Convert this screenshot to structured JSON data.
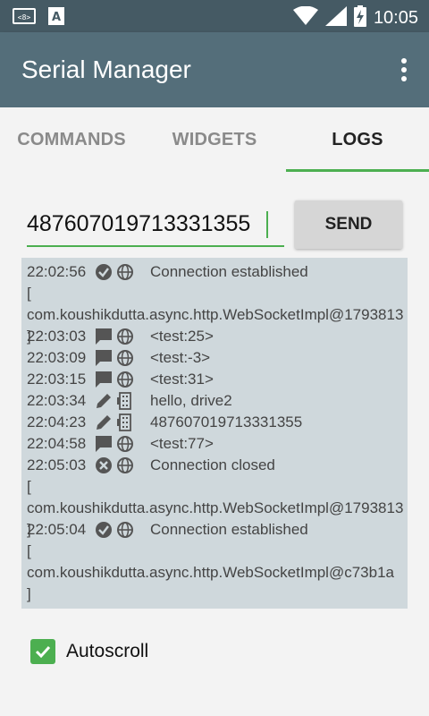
{
  "status_bar": {
    "time": "10:05",
    "icons": [
      "code-icon",
      "text-icon",
      "wifi-icon",
      "signal-icon",
      "battery-charging-icon"
    ]
  },
  "app_bar": {
    "title": "Serial Manager",
    "menu_icon": "more-vert-icon"
  },
  "tabs": [
    {
      "label": "COMMANDS",
      "active": false
    },
    {
      "label": "WIDGETS",
      "active": false
    },
    {
      "label": "LOGS",
      "active": true
    }
  ],
  "input": {
    "value": "487607019713331355"
  },
  "send_button": {
    "label": "SEND"
  },
  "log": {
    "entries": [
      {
        "time": "22:02:56",
        "icon1": "check-circle-icon",
        "icon2": "globe-icon",
        "message": "Connection established",
        "detail": "[ com.koushikdutta.async.http.WebSocketImpl@1793813 ]"
      },
      {
        "time": "22:03:03",
        "icon1": "message-icon",
        "icon2": "globe-icon",
        "message": "<test:25>"
      },
      {
        "time": "22:03:09",
        "icon1": "message-icon",
        "icon2": "globe-icon",
        "message": "<test:-3>"
      },
      {
        "time": "22:03:15",
        "icon1": "message-icon",
        "icon2": "globe-icon",
        "message": "<test:31>"
      },
      {
        "time": "22:03:34",
        "icon1": "pencil-icon",
        "icon2": "serial-port-icon",
        "message": "hello, drive2"
      },
      {
        "time": "22:04:23",
        "icon1": "pencil-icon",
        "icon2": "serial-port-icon",
        "message": "487607019713331355"
      },
      {
        "time": "22:04:58",
        "icon1": "message-icon",
        "icon2": "globe-icon",
        "message": "<test:77>"
      },
      {
        "time": "22:05:03",
        "icon1": "close-circle-icon",
        "icon2": "globe-icon",
        "message": "Connection closed",
        "detail": "[ com.koushikdutta.async.http.WebSocketImpl@1793813 ]"
      },
      {
        "time": "22:05:04",
        "icon1": "check-circle-icon",
        "icon2": "globe-icon",
        "message": "Connection established",
        "detail": "[ com.koushikdutta.async.http.WebSocketImpl@c73b1a ]"
      }
    ]
  },
  "autoscroll": {
    "label": "Autoscroll",
    "checked": true
  },
  "colors": {
    "status_bar": "#455a64",
    "app_bar": "#546e7a",
    "accent": "#4caf50",
    "log_background": "#cfd8dc"
  }
}
